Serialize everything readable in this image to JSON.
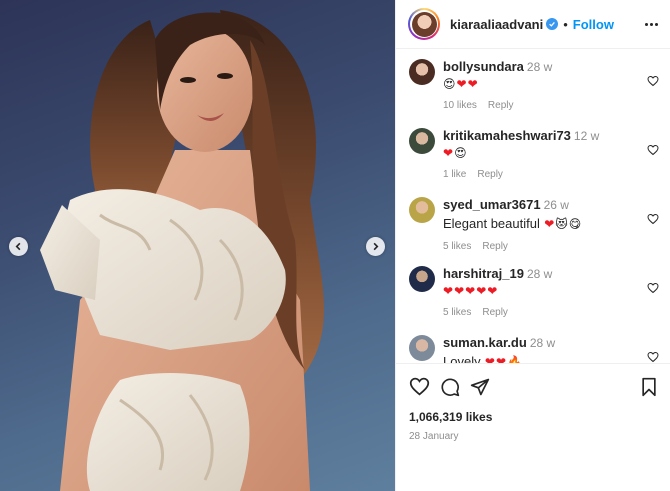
{
  "post": {
    "username": "kiaraaliaadvani",
    "separator": "•",
    "follow_label": "Follow",
    "likes": "1,066,319 likes",
    "date": "28 January"
  },
  "comments": [
    {
      "username": "bollysundara",
      "time": "28 w",
      "text": "",
      "emojis": [
        "heart-eyes-emoji",
        "red-heart-emoji",
        "red-heart-emoji"
      ],
      "likes": "10 likes",
      "reply": "Reply"
    },
    {
      "username": "kritikamaheshwari73",
      "time": "12 w",
      "text": "",
      "emojis": [
        "red-heart-emoji",
        "heart-eyes-emoji"
      ],
      "likes": "1 like",
      "reply": "Reply"
    },
    {
      "username": "syed_umar3671",
      "time": "26 w",
      "text": "Elegant beautiful",
      "emojis": [
        "red-heart-emoji",
        "heart-eyes-cat-emoji",
        "face-savoring-emoji"
      ],
      "likes": "5 likes",
      "reply": "Reply"
    },
    {
      "username": "harshitraj_19",
      "time": "28 w",
      "text": "",
      "emojis": [
        "red-heart-emoji",
        "red-heart-emoji",
        "red-heart-emoji",
        "red-heart-emoji",
        "red-heart-emoji"
      ],
      "likes": "5 likes",
      "reply": "Reply"
    },
    {
      "username": "suman.kar.du",
      "time": "28 w",
      "text": "Lovely",
      "emojis": [
        "red-heart-emoji",
        "red-heart-emoji",
        "fire-emoji"
      ],
      "likes": "",
      "reply": ""
    }
  ],
  "colors": {
    "accent": "#0095f6",
    "text": "#262626",
    "muted": "#8e8e8e",
    "heart": "#ed1c24"
  },
  "icons": [
    "chevron-left-icon",
    "chevron-right-icon",
    "verified-badge-icon",
    "more-options-icon",
    "heart-outline-icon",
    "comment-icon",
    "share-icon",
    "bookmark-icon"
  ]
}
